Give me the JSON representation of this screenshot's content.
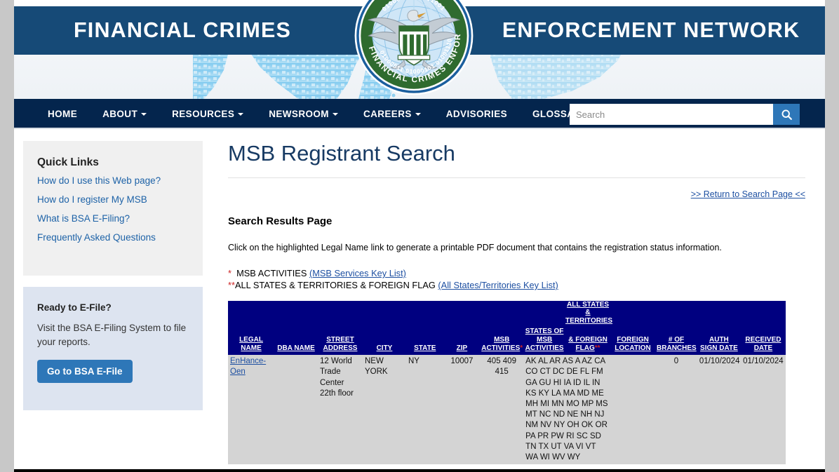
{
  "banner": {
    "title_left": "FINANCIAL CRIMES",
    "title_right": "ENFORCEMENT NETWORK",
    "seal_name": "fincen-seal"
  },
  "nav": {
    "items": [
      {
        "label": "HOME",
        "has_caret": false
      },
      {
        "label": "ABOUT",
        "has_caret": true
      },
      {
        "label": "RESOURCES",
        "has_caret": true
      },
      {
        "label": "NEWSROOM",
        "has_caret": true
      },
      {
        "label": "CAREERS",
        "has_caret": true
      },
      {
        "label": "ADVISORIES",
        "has_caret": false
      },
      {
        "label": "GLOSSARY",
        "has_caret": false
      }
    ],
    "search_placeholder": "Search",
    "search_value": ""
  },
  "sidebar": {
    "quick_links_title": "Quick Links",
    "quick_links": [
      "How do I use this Web page?",
      "How do I register My MSB",
      "What is BSA E-Filing?",
      "Frequently Asked Questions"
    ],
    "efile_title": "Ready to E-File?",
    "efile_text": "Visit the BSA E-Filing System to file your reports.",
    "efile_button": "Go to BSA E-File"
  },
  "main": {
    "page_title": "MSB Registrant Search",
    "return_link": ">> Return to Search Page <<",
    "results_heading": "Search Results Page",
    "results_desc": "Click on the highlighted Legal Name link to generate a printable PDF document that contains the registration status information.",
    "key_line_1_star": "*",
    "key_line_1_text": "MSB ACTIVITIES",
    "key_line_1_link": "(MSB Services Key List)",
    "key_line_2_star": "**",
    "key_line_2_text": "ALL STATES & TERRITORIES & FOREIGN FLAG",
    "key_line_2_link": "(All States/Territories Key List)"
  },
  "table": {
    "headers": [
      {
        "lines": [
          "LEGAL NAME"
        ],
        "star": ""
      },
      {
        "lines": [
          "DBA NAME"
        ],
        "star": ""
      },
      {
        "lines": [
          "STREET",
          "ADDRESS"
        ],
        "star": ""
      },
      {
        "lines": [
          "CITY"
        ],
        "star": ""
      },
      {
        "lines": [
          "STATE"
        ],
        "star": ""
      },
      {
        "lines": [
          "ZIP"
        ],
        "star": ""
      },
      {
        "lines": [
          "MSB",
          "ACTIVITIES"
        ],
        "star": "*"
      },
      {
        "lines": [
          "STATES OF",
          "MSB",
          "ACTIVITIES"
        ],
        "star": ""
      },
      {
        "lines": [
          "ALL STATES",
          "&",
          "TERRITORIES",
          "& FOREIGN",
          "FLAG"
        ],
        "star": "**"
      },
      {
        "lines": [
          "FOREIGN",
          "LOCATION"
        ],
        "star": ""
      },
      {
        "lines": [
          "# OF",
          "BRANCHES"
        ],
        "star": ""
      },
      {
        "lines": [
          "AUTH",
          "SIGN DATE"
        ],
        "star": ""
      },
      {
        "lines": [
          "RECEIVED",
          "DATE"
        ],
        "star": ""
      }
    ],
    "rows": [
      {
        "legal_name": "EnHance-Oen",
        "dba_name": "",
        "street_address": "12 World Trade Center 22th floor",
        "city": "NEW YORK",
        "state": "NY",
        "zip": "10007",
        "msb_activities": "405 409 415",
        "states_of_msb_activities": "AK AL AR AS A AZ CA CO CT DC DE FL FM GA GU HI IA ID IL IN KS KY LA MA MD ME MH MI MN MO MP MS MT NC ND NE NH NJ NM NV NY OH OK OR PA PR PW RI SC SD TN TX UT VA VI VT WA WI WV WY",
        "all_states_territories_foreign_flag": "",
        "foreign_location": "",
        "num_branches": "0",
        "auth_sign_date": "01/10/2024",
        "received_date": "01/10/2024"
      }
    ]
  },
  "colors": {
    "banner_blue": "#164a77",
    "nav_blue": "#04254d",
    "table_header_blue": "#000080",
    "table_row_gray": "#d4d4d4",
    "link_blue": "#1d4fa1",
    "button_blue": "#2e77b8"
  }
}
